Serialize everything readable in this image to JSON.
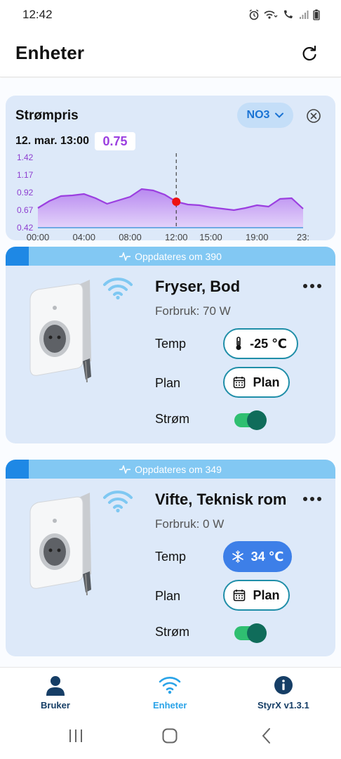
{
  "status": {
    "time": "12:42"
  },
  "header": {
    "title": "Enheter",
    "refresh_icon": "refresh-icon"
  },
  "price": {
    "title": "Strømpris",
    "region": "NO3",
    "date_label": "12. mar. 13:00",
    "current_value": "0.75",
    "accent_color": "#9b3fe0"
  },
  "chart_data": {
    "type": "area",
    "x_ticks": [
      "00:00",
      "04:00",
      "08:00",
      "12:00",
      "15:00",
      "19:00",
      "23:"
    ],
    "y_ticks": [
      "1.42",
      "1.17",
      "0.92",
      "0.67",
      "0.42"
    ],
    "ylim": [
      0.42,
      1.42
    ],
    "xlim": [
      0,
      23
    ],
    "x": [
      0,
      1,
      2,
      3,
      4,
      5,
      6,
      7,
      8,
      9,
      10,
      11,
      12,
      13,
      14,
      15,
      16,
      17,
      18,
      19,
      20,
      21,
      22,
      23
    ],
    "values": [
      0.7,
      0.8,
      0.87,
      0.88,
      0.9,
      0.84,
      0.76,
      0.81,
      0.86,
      0.97,
      0.95,
      0.89,
      0.79,
      0.75,
      0.74,
      0.71,
      0.69,
      0.67,
      0.7,
      0.74,
      0.72,
      0.83,
      0.84,
      0.69
    ],
    "marker_x": 12,
    "marker_value": 0.79,
    "grid": false,
    "line_color": "#9b3fe0",
    "marker_color": "#ee1111"
  },
  "devices": [
    {
      "update_text": "Oppdateres om 390",
      "update_progress": 0.07,
      "name": "Fryser, Bod",
      "usage": "Forbruk: 70 W",
      "temp_label": "Temp",
      "temp_value": "-25 ℃",
      "temp_icon": "thermometer-icon",
      "plan_label": "Plan",
      "plan_value": "Plan",
      "power_label": "Strøm",
      "power_on": true
    },
    {
      "update_text": "Oppdateres om 349",
      "update_progress": 0.07,
      "name": "Vifte, Teknisk rom",
      "usage": "Forbruk: 0 W",
      "temp_label": "Temp",
      "temp_value": "34 ℃",
      "temp_icon": "snowflake-icon",
      "plan_label": "Plan",
      "plan_value": "Plan",
      "power_label": "Strøm",
      "power_on": true
    }
  ],
  "nav": {
    "user": "Bruker",
    "devices": "Enheter",
    "about": "StyrX v1.3.1"
  }
}
